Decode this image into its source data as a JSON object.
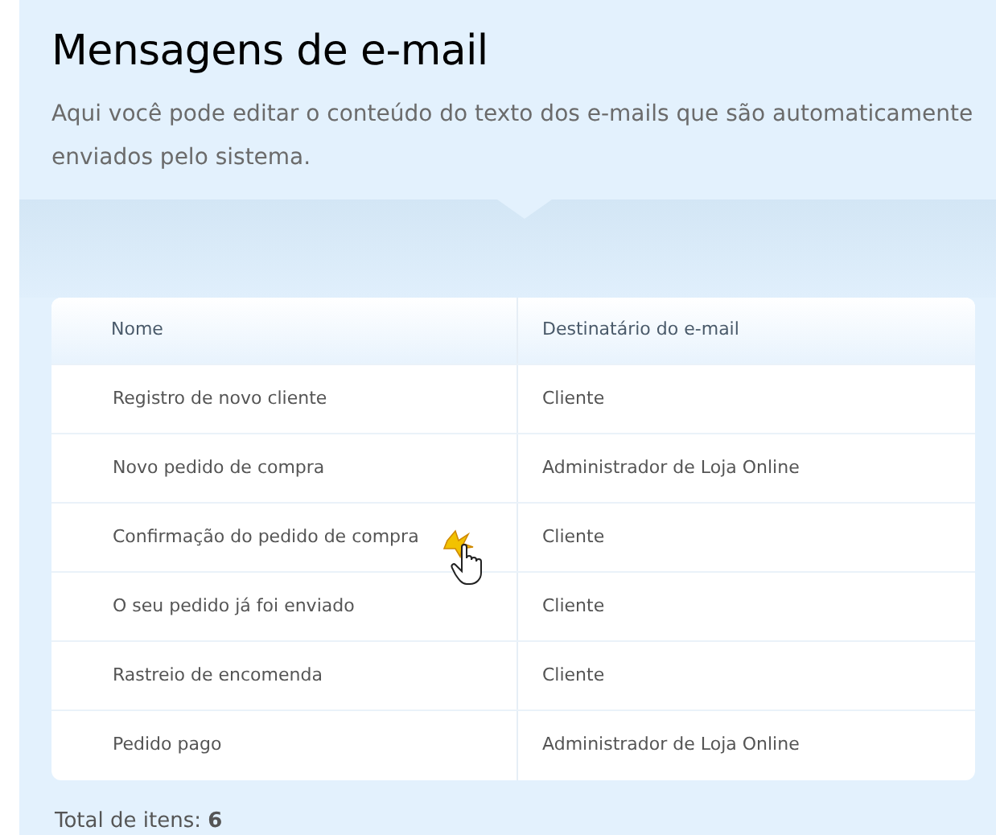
{
  "title": "Mensagens de e-mail",
  "description": "Aqui você pode editar o conteúdo do texto dos e-mails que são automaticamente enviados pelo sistema.",
  "table": {
    "columns": [
      "Nome",
      "Destinatário do e-mail"
    ],
    "rows": [
      {
        "name": "Registro de novo cliente",
        "recipient": "Cliente"
      },
      {
        "name": "Novo pedido de compra",
        "recipient": "Administrador de Loja Online"
      },
      {
        "name": "Confirmação do pedido de compra",
        "recipient": "Cliente"
      },
      {
        "name": "O seu pedido já foi enviado",
        "recipient": "Cliente"
      },
      {
        "name": "Rastreio de encomenda",
        "recipient": "Cliente"
      },
      {
        "name": "Pedido pago",
        "recipient": "Administrador de Loja Online"
      }
    ]
  },
  "total": "Total de itens: **6**"
}
